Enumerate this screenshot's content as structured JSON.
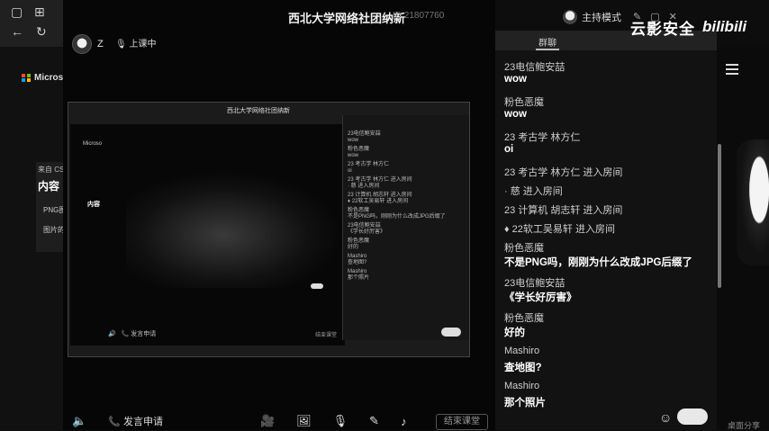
{
  "window": {
    "title": "西北大学网络社团纳新",
    "id_label": "ID 21807760",
    "host_label": "主持模式"
  },
  "user": {
    "name": "Z",
    "status": "上课中"
  },
  "left_app": {
    "logo_text": "Microso"
  },
  "left_card": {
    "from": "来自 CS",
    "heading": "内容",
    "items": [
      "PNG图",
      "图片的"
    ]
  },
  "chat": {
    "tab": "群聊",
    "messages": [
      {
        "name": "23电信鲍安喆",
        "text": "wow"
      },
      {
        "name": "粉色恶魔",
        "text": "wow"
      },
      {
        "name": "23 考古学 林方仁",
        "text": "oi"
      },
      {
        "event": "23 考古学 林方仁 进入房间"
      },
      {
        "event": "· 慈 进入房间"
      },
      {
        "event": "23 计算机 胡志轩 进入房间"
      },
      {
        "event": "♦ 22软工吴易轩 进入房间"
      },
      {
        "name": "粉色恶魔",
        "text": "不是PNG吗，刚刚为什么改成JPG后缀了"
      },
      {
        "name": "23电信鲍安喆",
        "text": "《学长好厉害》"
      },
      {
        "name": "粉色恶魔",
        "text": "好的"
      },
      {
        "name": "Mashiro",
        "text": "查地图?"
      },
      {
        "name": "Mashiro",
        "text": "那个照片"
      }
    ]
  },
  "toolbar": {
    "apply_label": "发言申请",
    "end_label": "结束课堂"
  },
  "watermark": {
    "text": "云影安全",
    "brand": "bilibili"
  },
  "footer": {
    "share": "桌面分享"
  },
  "nested_chat_lines": [
    "23电信鲍安喆",
    "wow",
    "粉色恶魔",
    "wow",
    "23 考古学 林方仁",
    "oi",
    "23 考古学 林方仁 进入房间",
    "· 慈 进入房间",
    "23 计算机 胡志轩 进入房间",
    "♦ 22软工吴易轩 进入房间",
    "粉色恶魔",
    "不是PNG吗，刚刚为什么改成JPG后缀了",
    "23电信鲍安喆",
    "《学长好厉害》",
    "粉色恶魔",
    "好的",
    "Mashiro",
    "查地图?",
    "Mashiro",
    "那个照片"
  ],
  "nested": {
    "title": "西北大学网络社团纳新",
    "logo": "Microso",
    "card_heading": "内容"
  }
}
